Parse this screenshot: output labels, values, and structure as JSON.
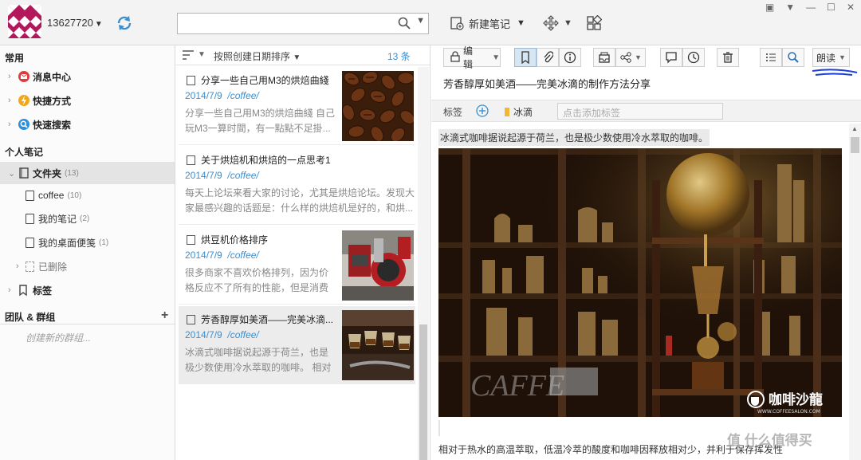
{
  "account": {
    "name": "13627720"
  },
  "toolbar": {
    "new_note_label": "新建笔记"
  },
  "window_controls": [
    "shirt-icon",
    "dropdown-icon",
    "minimize-icon",
    "maximize-icon",
    "close-icon"
  ],
  "sidebar": {
    "section_common": "常用",
    "common_items": [
      {
        "label": "消息中心",
        "icon": "message-icon"
      },
      {
        "label": "快捷方式",
        "icon": "bolt-icon"
      },
      {
        "label": "快速搜索",
        "icon": "search-icon"
      }
    ],
    "section_personal": "个人笔记",
    "folder": {
      "label": "文件夹",
      "count": "(13)"
    },
    "notebooks": [
      {
        "label": "coffee",
        "count": "(10)"
      },
      {
        "label": "我的笔记",
        "count": "(2)"
      },
      {
        "label": "我的桌面便笺",
        "count": "(1)"
      }
    ],
    "trash_label": "已删除",
    "tags_label": "标签",
    "section_team": "团队 & 群组",
    "create_group_placeholder": "创建新的群组..."
  },
  "note_list": {
    "sort_label": "按照创建日期排序",
    "count_label": "13 条",
    "items": [
      {
        "title": "分享一些自己用M3的烘焙曲綫",
        "date": "2014/7/9",
        "folder": "/coffee/",
        "snippet": "分享一些自己用M3的烘焙曲綫 自己玩M3一算时間，有一點點不足掛..."
      },
      {
        "title": "关于烘焙机和烘焙的一点思考1",
        "date": "2014/7/9",
        "folder": "/coffee/",
        "snippet": "每天上论坛来看大家的讨论，尤其是烘焙论坛。发现大家最感兴趣的话题是：什么样的烘焙机是好的，和烘..."
      },
      {
        "title": "烘豆机价格排序",
        "date": "2014/7/9",
        "folder": "/coffee/",
        "snippet": "很多商家不喜欢价格排列，因为价格反应不了所有的性能，但是消费者..."
      },
      {
        "title": "芳香醇厚如美酒——完美冰滴...",
        "date": "2014/7/9",
        "folder": "/coffee/",
        "snippet": "冰滴式咖啡据说起源于荷兰，也是极少数使用冷水萃取的咖啡。 相对于..."
      }
    ]
  },
  "editor": {
    "edit_label": "编辑",
    "read_label": "朗读",
    "title": "芳香醇厚如美酒——完美冰滴的制作方法分享",
    "tags_label": "标签",
    "tag": "冰滴",
    "tag_placeholder": "点击添加标签",
    "intro": "冰滴式咖啡据说起源于荷兰，也是极少数使用冷水萃取的咖啡。",
    "photo_logo": "咖啡沙龍",
    "photo_logo_sub": "WWW.COFFEESALON.COM",
    "photo_brand": "CAFFE",
    "paragraph": "相对于热水的高温萃取，低温冷萃的酸度和咖啡因释放相对少，并利于保存挥发性"
  },
  "watermark": "值 什么值得买",
  "colors": {
    "accent": "#3a8fd1",
    "logo": "#b3185a"
  }
}
